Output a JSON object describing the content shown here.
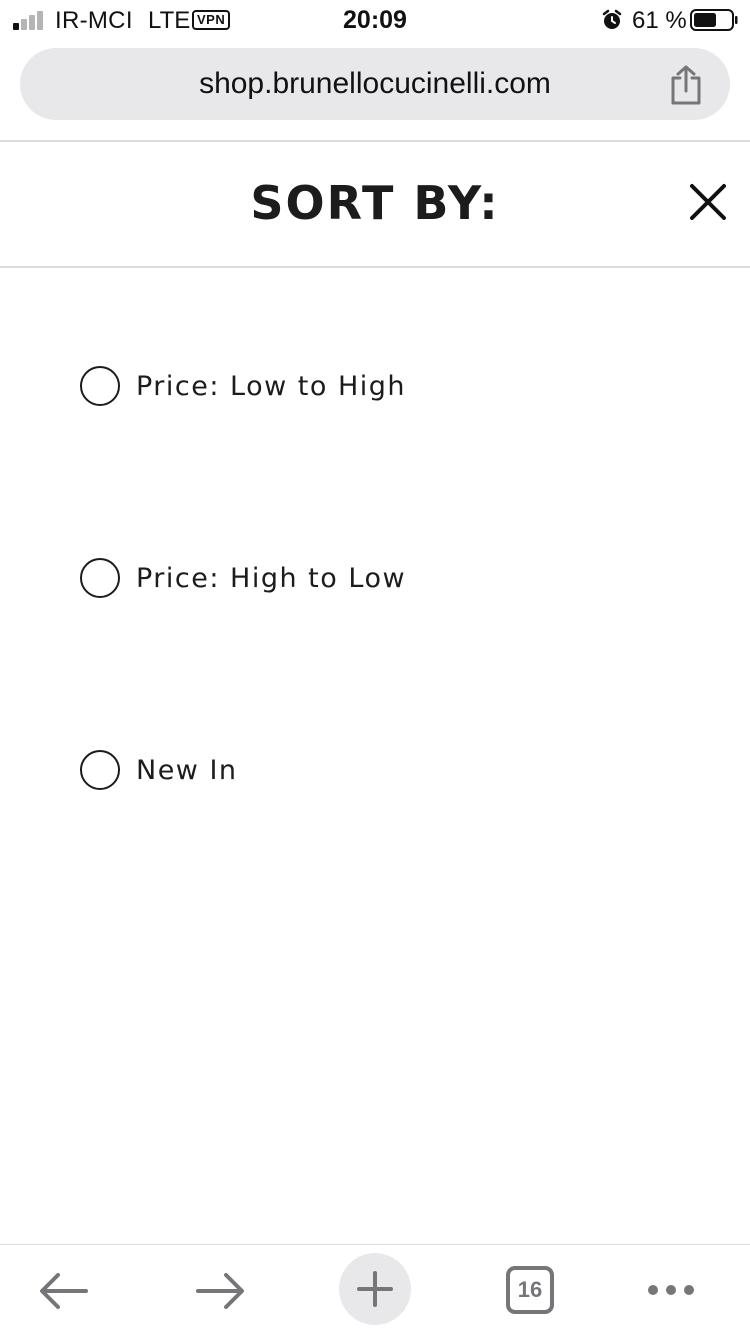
{
  "status_bar": {
    "carrier": "IR-MCI",
    "network": "LTE",
    "vpn": "VPN",
    "time": "20:09",
    "battery_percent": "61 %",
    "battery_level": 0.61,
    "signal_bars_active": 1,
    "signal_bars_total": 4
  },
  "browser": {
    "url": "shop.brunellocucinelli.com",
    "open_tabs": "16",
    "icons": [
      "share-icon",
      "back-arrow-icon",
      "forward-arrow-icon",
      "plus-icon",
      "tabs-icon",
      "more-icon"
    ]
  },
  "sort_panel": {
    "title": "SORT BY:",
    "close_icon": "close-icon",
    "options": [
      {
        "label": "Price: Low to High",
        "selected": false
      },
      {
        "label": "Price: High to Low",
        "selected": false
      },
      {
        "label": "New In",
        "selected": false
      }
    ]
  },
  "colors": {
    "text": "#1c1c1c",
    "url_bar_bg": "#e8e8ea",
    "toolbar_icon": "#76767a",
    "divider": "#dcdcdc"
  }
}
